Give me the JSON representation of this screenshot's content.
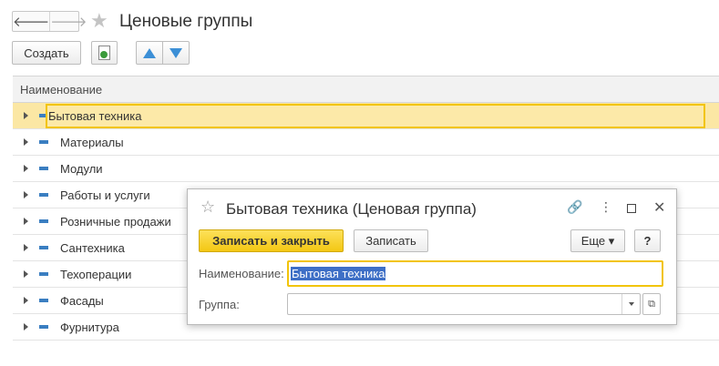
{
  "header": {
    "back_icon": "arrow-left-icon",
    "forward_icon": "arrow-right-icon",
    "back_glyph": "🡐",
    "forward_glyph": "🡒",
    "favorite_icon": "star-icon",
    "favorite_glyph": "★",
    "title": "Ценовые группы"
  },
  "toolbar": {
    "create_label": "Создать",
    "copy_icon": "document-add-icon",
    "move_up_icon": "arrow-up-icon",
    "move_down_icon": "arrow-down-icon"
  },
  "table": {
    "column_header": "Наименование",
    "rows": [
      {
        "label": "Бытовая техника",
        "selected": true
      },
      {
        "label": "Материалы",
        "selected": false
      },
      {
        "label": "Модули",
        "selected": false
      },
      {
        "label": "Работы и услуги",
        "selected": false
      },
      {
        "label": "Розничные продажи",
        "selected": false
      },
      {
        "label": "Сантехника",
        "selected": false
      },
      {
        "label": "Техоперации",
        "selected": false
      },
      {
        "label": "Фасады",
        "selected": false
      },
      {
        "label": "Фурнитура",
        "selected": false
      }
    ]
  },
  "dialog": {
    "favorite_glyph": "☆",
    "title": "Бытовая техника (Ценовая группа)",
    "link_glyph": "🔗",
    "more_glyph": "⋮",
    "close_glyph": "✕",
    "save_close_label": "Записать и закрыть",
    "save_label": "Записать",
    "more_label": "Еще ▾",
    "help_label": "?",
    "name_label": "Наименование:",
    "name_value": "Бытовая техника",
    "group_label": "Группа:",
    "group_value": "",
    "open_glyph": "⧉"
  },
  "colors": {
    "accent_yellow": "#f2c40a",
    "selected_row": "#fbe7a4",
    "text_selection": "#3e6fc6",
    "group_icon": "#3a7ec1"
  }
}
